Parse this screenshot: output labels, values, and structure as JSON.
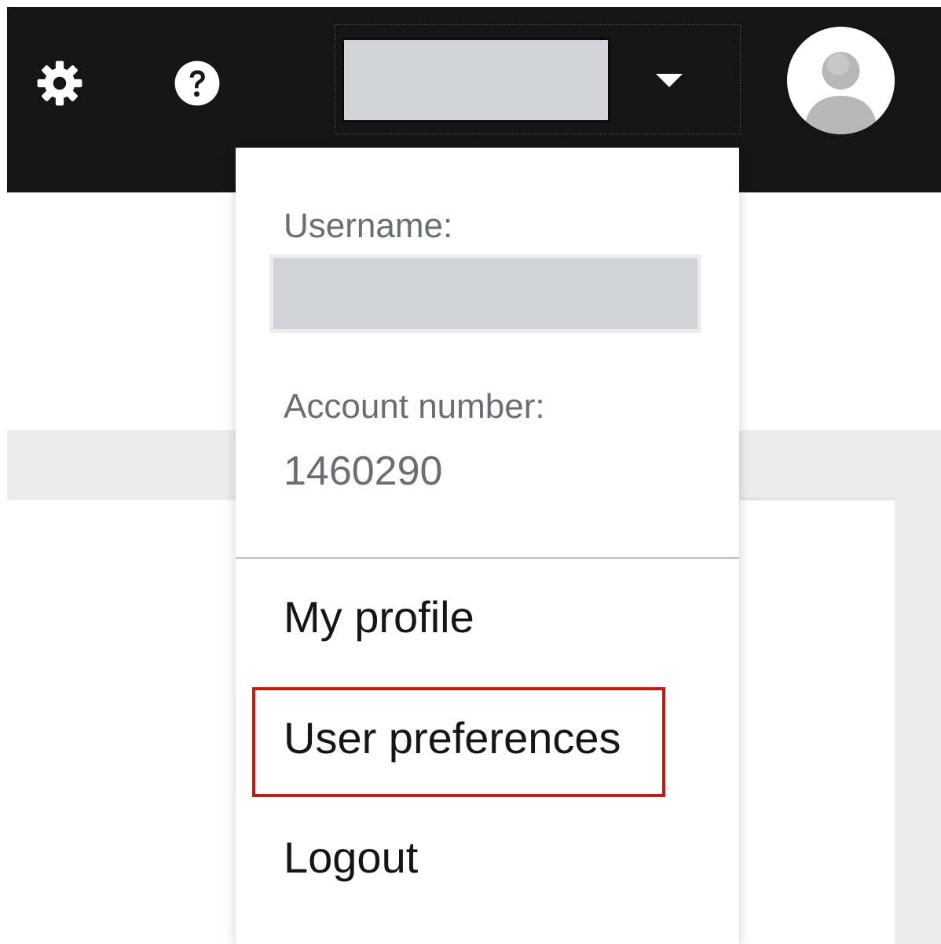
{
  "header": {
    "settings_icon": "gear-icon",
    "help_icon": "question-circle-icon",
    "user_menu_caret_icon": "caret-down-icon",
    "avatar_icon": "user-avatar-icon",
    "background_color": "#151515"
  },
  "dropdown": {
    "username_label": "Username:",
    "account_label": "Account number:",
    "account_value": "1460290",
    "items": [
      {
        "label": "My profile"
      },
      {
        "label": "User preferences",
        "highlighted": true
      },
      {
        "label": "Logout"
      }
    ]
  },
  "colors": {
    "highlight": "#c9190b",
    "redacted": "#d2d2d9",
    "muted_text": "#6a6e73",
    "text": "#151515"
  }
}
